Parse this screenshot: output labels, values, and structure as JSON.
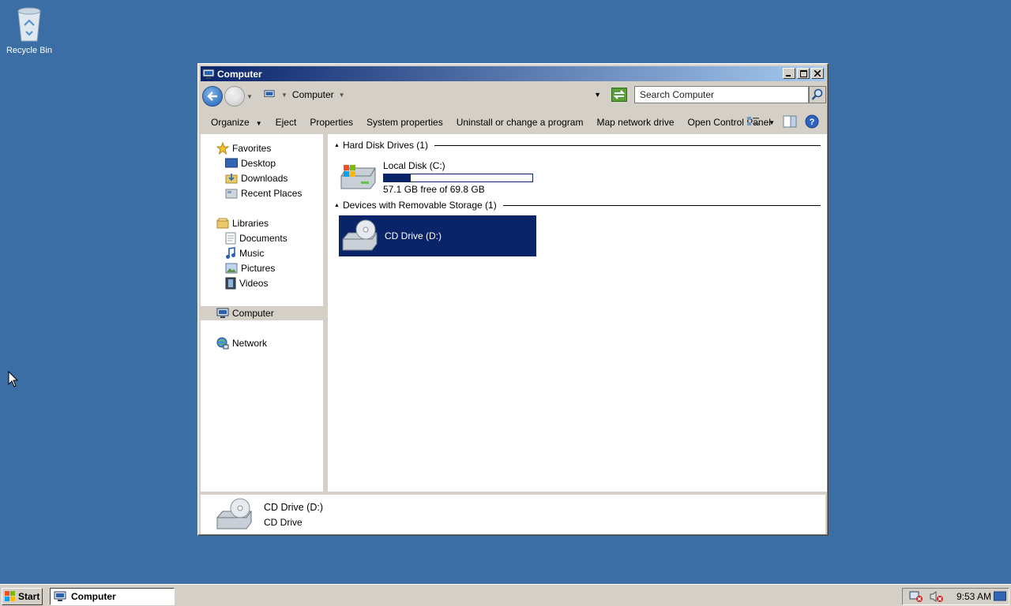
{
  "desktop": {
    "recycle_bin_label": "Recycle Bin"
  },
  "window": {
    "title": "Computer",
    "controls": {
      "minimize": "minimize",
      "maximize": "maximize",
      "close": "close"
    }
  },
  "address_bar": {
    "path": "Computer",
    "search_placeholder": "Search Computer"
  },
  "command_bar": {
    "organize": "Organize",
    "eject": "Eject",
    "properties": "Properties",
    "system_properties": "System properties",
    "uninstall": "Uninstall or change a program",
    "map_network_drive": "Map network drive",
    "open_control_panel": "Open Control Panel"
  },
  "nav_pane": {
    "favorites": "Favorites",
    "desktop": "Desktop",
    "downloads": "Downloads",
    "recent_places": "Recent Places",
    "libraries": "Libraries",
    "documents": "Documents",
    "music": "Music",
    "pictures": "Pictures",
    "videos": "Videos",
    "computer": "Computer",
    "network": "Network"
  },
  "content": {
    "hard_disk_group": "Hard Disk Drives (1)",
    "removable_group": "Devices with Removable Storage (1)",
    "local_disk": {
      "name": "Local Disk (C:)",
      "free_text": "57.1 GB free of 69.8 GB",
      "used_fraction": 0.18
    },
    "cd_drive": {
      "name": "CD Drive (D:)"
    }
  },
  "details_pane": {
    "name": "CD Drive (D:)",
    "type": "CD Drive"
  },
  "taskbar": {
    "start_label": "Start",
    "task_label": "Computer",
    "clock": "9:53 AM"
  },
  "colors": {
    "desktop": "#3a6ea5",
    "selection": "#0a246a",
    "chrome": "#d4d0c8"
  }
}
